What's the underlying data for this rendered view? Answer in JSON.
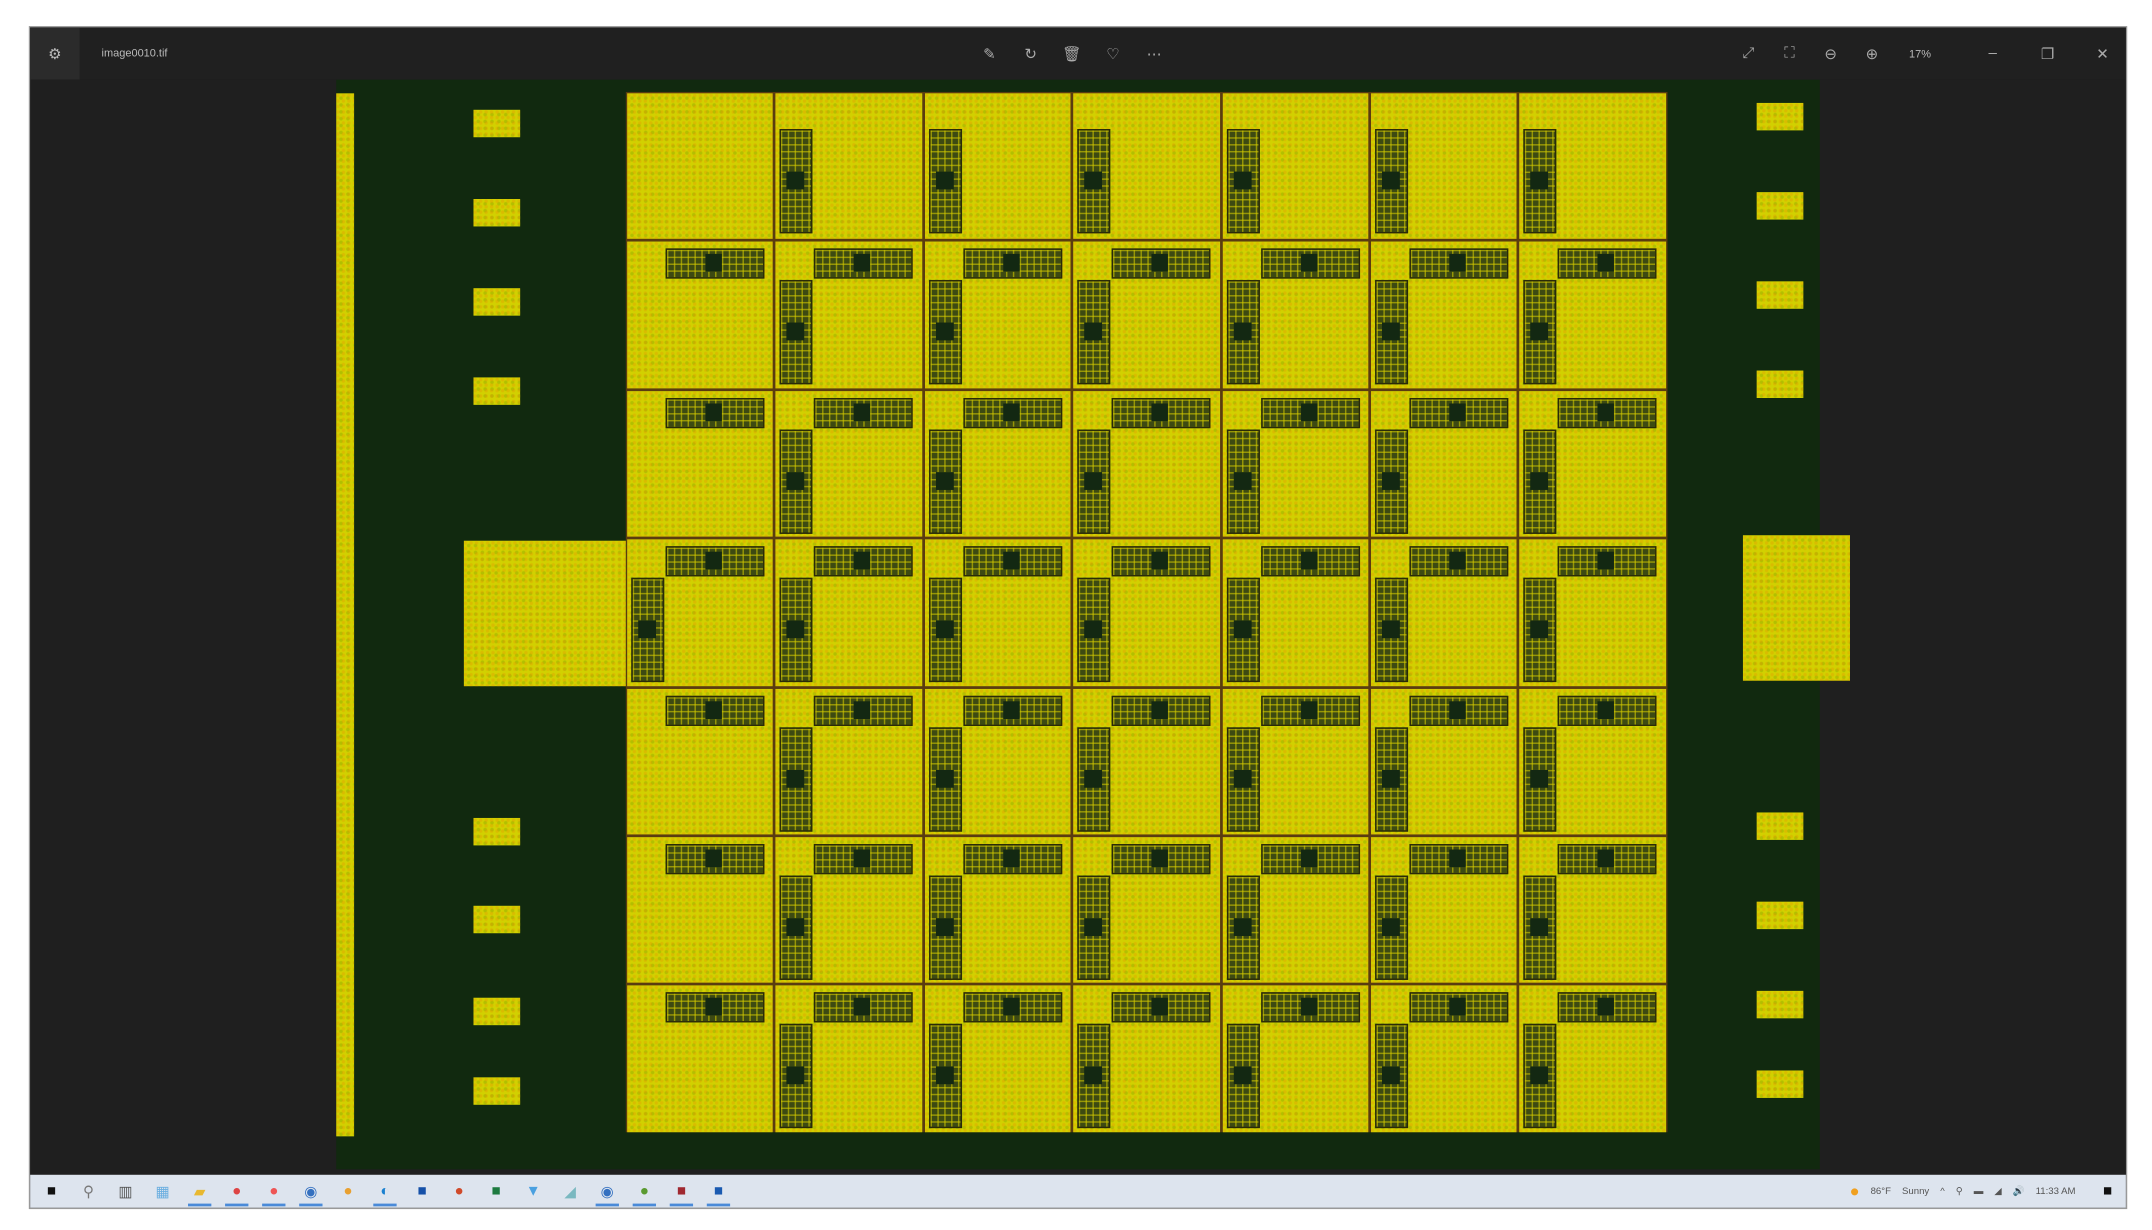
{
  "window": {
    "title": "image0010.tif",
    "zoom_level": "17%"
  },
  "toolbar": {
    "center": [
      "edit-image-icon",
      "rotate-icon",
      "delete-icon",
      "favorite-icon",
      "more-icon"
    ],
    "right": [
      "fullscreen-icon",
      "fit-to-window-icon",
      "zoom-out-icon",
      "zoom-in-icon"
    ]
  },
  "taskbar": {
    "apps": [
      {
        "name": "start",
        "glyph": "■",
        "color": "#111",
        "running": false
      },
      {
        "name": "search",
        "glyph": "⚲",
        "color": "#777",
        "running": false
      },
      {
        "name": "task-view",
        "glyph": "▥",
        "color": "#555",
        "running": false
      },
      {
        "name": "widgets",
        "glyph": "▦",
        "color": "#6aaee0",
        "running": false
      },
      {
        "name": "file-explorer",
        "glyph": "▰",
        "color": "#e8b830",
        "running": true
      },
      {
        "name": "chrome",
        "glyph": "●",
        "color": "#d44",
        "running": true
      },
      {
        "name": "firefox",
        "glyph": "●",
        "color": "#e55",
        "running": true
      },
      {
        "name": "app-blue-circle",
        "glyph": "◉",
        "color": "#3470c0",
        "running": true
      },
      {
        "name": "chrome-2",
        "glyph": "●",
        "color": "#e8a030",
        "running": false
      },
      {
        "name": "edge",
        "glyph": "◐",
        "color": "#1a80d0",
        "running": true
      },
      {
        "name": "outlook",
        "glyph": "■",
        "color": "#1550a8",
        "running": false
      },
      {
        "name": "powerpoint",
        "glyph": "●",
        "color": "#d04a2a",
        "running": false
      },
      {
        "name": "excel",
        "glyph": "■",
        "color": "#1d7a40",
        "running": false
      },
      {
        "name": "chat",
        "glyph": "▼",
        "color": "#4aa0e0",
        "running": false
      },
      {
        "name": "app-teal",
        "glyph": "◢",
        "color": "#7ab8c0",
        "running": false
      },
      {
        "name": "app-blue-circle-2",
        "glyph": "◉",
        "color": "#3470c0",
        "running": true
      },
      {
        "name": "chrome-3",
        "glyph": "●",
        "color": "#5a9a30",
        "running": true
      },
      {
        "name": "app-red",
        "glyph": "■",
        "color": "#a02830",
        "running": true
      },
      {
        "name": "photos",
        "glyph": "■",
        "color": "#1a5ab0",
        "running": true
      }
    ],
    "weather": {
      "temp": "86°F",
      "condition": "Sunny"
    },
    "time": "11:33 AM"
  },
  "colors": {
    "chip_bg": "#11290f",
    "metal": "#d2d000",
    "grid_line": "#5a3c10"
  }
}
